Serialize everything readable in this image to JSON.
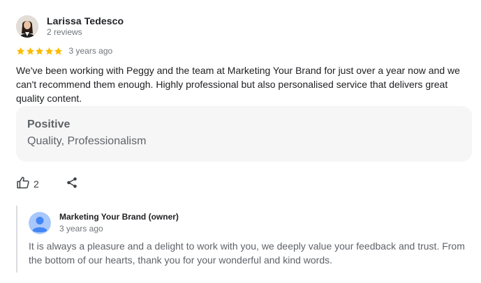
{
  "review": {
    "reviewer_name": "Larissa Tedesco",
    "reviewer_meta": "2 reviews",
    "rating": 5,
    "rating_max": 5,
    "date": "3 years ago",
    "text": "We've been working with Peggy and the team at Marketing Your Brand for just over a year now and we can't recommend them enough. Highly professional but also personalised service that delivers great quality content.",
    "attributes": {
      "title": "Positive",
      "values": "Quality, Professionalism"
    },
    "actions": {
      "like_count": "2",
      "like_icon": "thumb-up-icon",
      "share_icon": "share-icon"
    },
    "owner_reply": {
      "name": "Marketing Your Brand (owner)",
      "date": "3 years ago",
      "text": "It is always a pleasure and a delight to work with you, we deeply value your feedback and trust. From the bottom of our hearts, thank you for your wonderful and kind words."
    },
    "colors": {
      "star": "#fbbc04",
      "owner_avatar_bg": "#a8c7fa",
      "owner_avatar_fg": "#4285f4"
    }
  }
}
